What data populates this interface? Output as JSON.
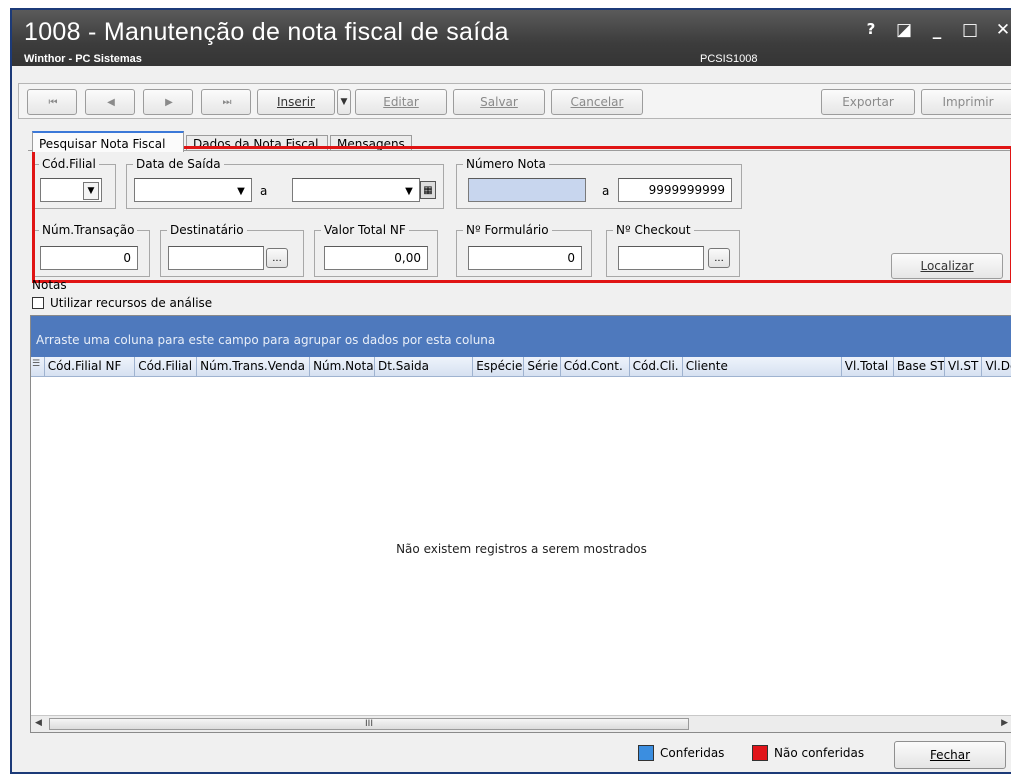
{
  "window": {
    "title": "1008 - Manutenção de nota fiscal de saída",
    "subtitle": "Winthor - PC Sistemas",
    "code": "PCSIS1008",
    "controls": [
      "?",
      "◪",
      "_",
      "□",
      "✕"
    ]
  },
  "toolbar": {
    "first": "⏮",
    "prev": "◀",
    "next": "▶",
    "last": "⏭",
    "inserir": "Inserir",
    "editar": "Editar",
    "salvar": "Salvar",
    "cancelar": "Cancelar",
    "exportar": "Exportar",
    "imprimir": "Imprimir"
  },
  "tabs": [
    "Pesquisar Nota Fiscal",
    "Dados da Nota Fiscal",
    "Mensagens"
  ],
  "filters": {
    "cod_filial": {
      "label": "Cód.Filial",
      "value": ""
    },
    "data_saida": {
      "label": "Data de Saída",
      "from": "",
      "sep": "a",
      "to": ""
    },
    "numero_nota": {
      "label": "Número Nota",
      "from": "",
      "sep": "a",
      "to": "9999999999"
    },
    "num_transacao": {
      "label": "Núm.Transação",
      "value": "0"
    },
    "destinatario": {
      "label": "Destinatário",
      "value": "",
      "btn": "..."
    },
    "valor_total": {
      "label": "Valor Total NF",
      "value": "0,00"
    },
    "formulario": {
      "label": "Nº Formulário",
      "value": "0"
    },
    "checkout": {
      "label": "Nº Checkout",
      "value": "",
      "btn": "..."
    },
    "localizar": "Localizar"
  },
  "notas": {
    "label": "Notas",
    "analise": "Utilizar recursos de análise",
    "group_hint": "Arraste uma coluna para este campo para agrupar os dados por esta coluna",
    "columns": [
      "Cód.Filial NF",
      "Cód.Filial",
      "Núm.Trans.Venda",
      "Núm.Nota",
      "Dt.Saida",
      "Espécie",
      "Série",
      "Cód.Cont.",
      "Cód.Cli.",
      "Cliente",
      "Vl.Total",
      "Base ST",
      "Vl.ST",
      "Vl.De"
    ],
    "empty": "Não existem registros a serem mostrados",
    "scroll_thumb": "III"
  },
  "footer": {
    "conferidas": "Conferidas",
    "nao_conferidas": "Não conferidas",
    "fechar": "Fechar",
    "color_conferidas": "#3b8ee0",
    "color_nao": "#e0141a"
  }
}
